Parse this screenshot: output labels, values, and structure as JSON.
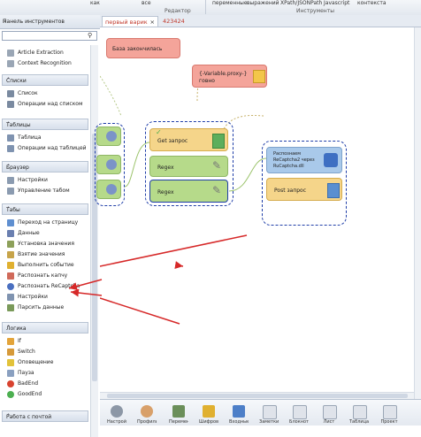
{
  "ribbon": {
    "items": [
      "как",
      "все",
      "переменные",
      "выражений",
      "XPath/JSONPath",
      "Javascript",
      "контекста"
    ],
    "groups": [
      "Редактор",
      "Инструменты"
    ]
  },
  "left_panel": {
    "title": "Панель инструментов",
    "close": "×",
    "search_placeholder": "",
    "top_items": [
      "Article Extraction",
      "Context Recognition"
    ],
    "sections": [
      {
        "title": "Списки",
        "items": [
          "Список",
          "Операции над списком"
        ]
      },
      {
        "title": "Таблицы",
        "items": [
          "Таблица",
          "Операции над таблицей"
        ]
      },
      {
        "title": "Браузер",
        "items": [
          "Настройки",
          "Управление табом"
        ]
      },
      {
        "title": "Табы",
        "items": [
          "Переход на страницу",
          "Данные",
          "Установка значения",
          "Взятие значения",
          "Выполнить событие",
          "Распознать капчу",
          "Распознать ReCaptcha",
          "Настройки",
          "Парсить данные"
        ]
      },
      {
        "title": "Логика",
        "items": [
          "If",
          "Switch",
          "Оповещение",
          "Пауза",
          "BadEnd",
          "GoodEnd"
        ]
      },
      {
        "title": "Работа с почтой",
        "items": []
      }
    ]
  },
  "tabs": [
    {
      "label": "первый варик",
      "active": true,
      "close": "×"
    },
    {
      "label": "423424",
      "active": false
    }
  ],
  "canvas": {
    "nodes": {
      "base_done": "База закончилась",
      "proxy_var": "{-Variable.proxy-}",
      "proxy_sub": "говно",
      "get_request": "Get запрос",
      "regex1": "Regex",
      "regex2": "Regex",
      "recaptcha_l1": "Распознаем",
      "recaptcha_l2": "ReCaptcha2 через",
      "recaptcha_l3": "RuCaptcha.dll",
      "post_request": "Post запрос"
    }
  },
  "bottom_toolbar": {
    "buttons": [
      "Настройки",
      "Профиль",
      "Переменные",
      "Шифрование",
      "Входные",
      "Заметки",
      "Блокнот",
      "Лист",
      "Таблица",
      "Проект"
    ]
  },
  "colors": {
    "accent_blue": "#1f3ea8",
    "node_red": "#f4a49a",
    "node_green": "#b6da8a",
    "node_yellow": "#f5d58a",
    "node_blue": "#a9c9ea",
    "arrow_red": "#d62828"
  }
}
